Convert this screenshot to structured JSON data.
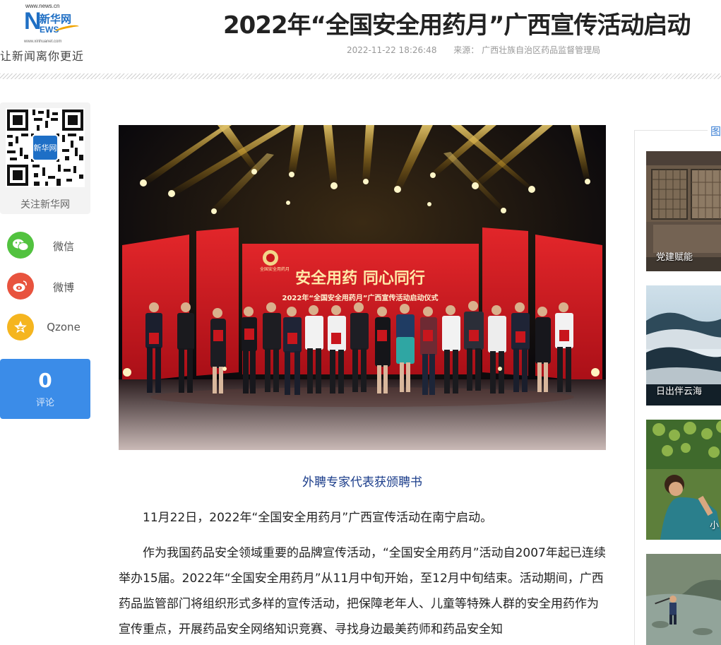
{
  "header": {
    "site_small": "www.news.cn",
    "logo_cn": "新华网",
    "logo_en_initial": "N",
    "logo_en_rest": "EWS",
    "logo_domain": "www.xinhuanet.com",
    "slogan": "让新闻离你更近",
    "title": "2022年“全国安全用药月”广西宣传活动启动",
    "date": "2022-11-22 18:26:48",
    "source": "来源： 广西壮族自治区药品监督管理局"
  },
  "sidebar": {
    "qr_label": "关注新华网",
    "qr_center": "新华网",
    "share": [
      {
        "label": "微信",
        "icon": "wechat-icon",
        "color": "#52c23f"
      },
      {
        "label": "微博",
        "icon": "weibo-icon",
        "color": "#e8533e"
      },
      {
        "label": "Qzone",
        "icon": "qzone-icon",
        "color": "#f5b51f"
      }
    ],
    "comment_count": "0",
    "comment_label": "评论"
  },
  "photo": {
    "backdrop_slogan": "安全用药 同心同行",
    "backdrop_title": "2022年“全国安全用药月”广西宣传活动启动仪式",
    "backdrop_badge": "全国安全用药月"
  },
  "caption": "外聘专家代表获颁聘书",
  "article": {
    "paragraphs": [
      "11月22日，2022年“全国安全用药月”广西宣传活动在南宁启动。",
      "作为我国药品安全领域重要的品牌宣传活动，“全国安全用药月”活动自2007年起已连续举办15届。2022年“全国安全用药月”从11月中旬开始，至12月中旬结束。活动期间，广西药品监管部门将组织形式多样的宣传活动，把保障老年人、儿童等特殊人群的安全用药作为宣传重点，开展药品安全网络知识竞赛、寻找身边最美药师和药品安全知"
    ]
  },
  "right": {
    "heading": "图片",
    "items": [
      {
        "caption": "党建赋能"
      },
      {
        "caption": "日出伴云海"
      },
      {
        "caption": "小"
      },
      {
        "caption": ""
      }
    ]
  },
  "colors": {
    "accent_blue": "#3b8ce8",
    "title_text": "#222222",
    "caption_blue": "#1a3c8a",
    "stage_red": "#c8161d"
  }
}
